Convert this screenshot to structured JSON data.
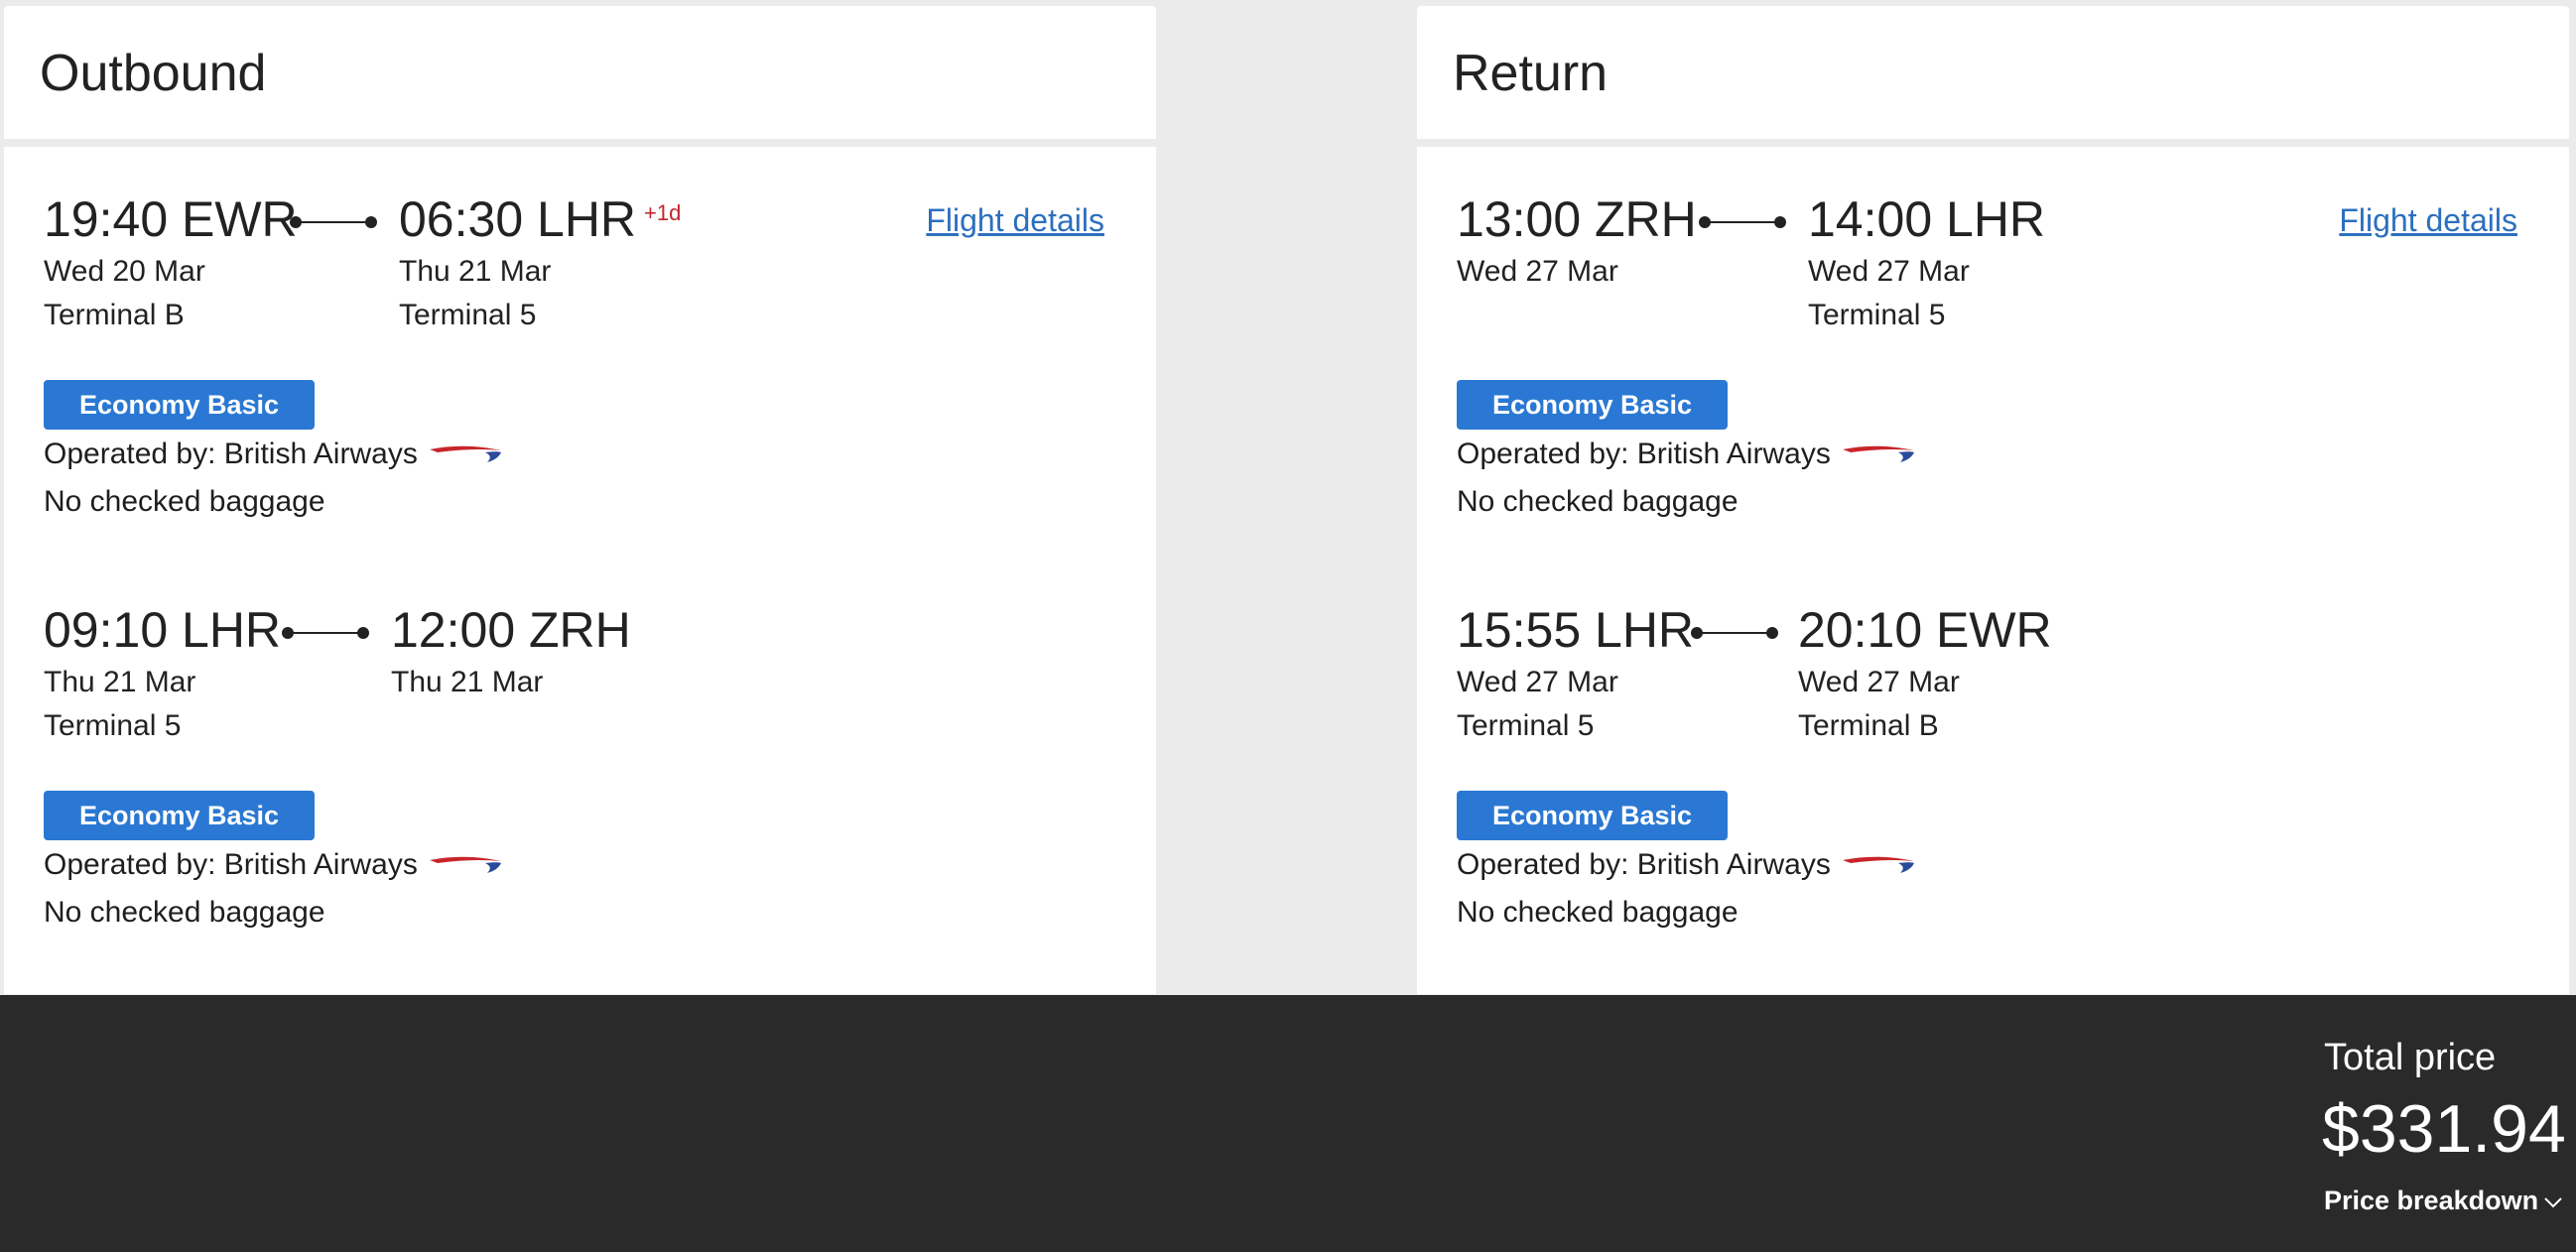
{
  "outbound": {
    "title": "Outbound",
    "details_link": "Flight details",
    "segments": [
      {
        "depart": {
          "time": "19:40 EWR",
          "date": "Wed 20 Mar",
          "terminal": "Terminal B"
        },
        "arrive": {
          "time": "06:30 LHR",
          "plus_day": "+1d",
          "date": "Thu 21 Mar",
          "terminal": "Terminal 5"
        },
        "cabin": "Economy Basic",
        "operated": "Operated by: British Airways",
        "baggage": "No checked baggage"
      },
      {
        "depart": {
          "time": "09:10 LHR",
          "date": "Thu 21 Mar",
          "terminal": "Terminal 5"
        },
        "arrive": {
          "time": "12:00 ZRH",
          "date": "Thu 21 Mar",
          "terminal": ""
        },
        "cabin": "Economy Basic",
        "operated": "Operated by: British Airways",
        "baggage": "No checked baggage"
      }
    ]
  },
  "return": {
    "title": "Return",
    "details_link": "Flight details",
    "segments": [
      {
        "depart": {
          "time": "13:00 ZRH",
          "date": "Wed 27 Mar",
          "terminal": ""
        },
        "arrive": {
          "time": "14:00 LHR",
          "date": "Wed 27 Mar",
          "terminal": "Terminal 5"
        },
        "cabin": "Economy Basic",
        "operated": "Operated by: British Airways",
        "baggage": "No checked baggage"
      },
      {
        "depart": {
          "time": "15:55 LHR",
          "date": "Wed 27 Mar",
          "terminal": "Terminal 5"
        },
        "arrive": {
          "time": "20:10 EWR",
          "date": "Wed 27 Mar",
          "terminal": "Terminal B"
        },
        "cabin": "Economy Basic",
        "operated": "Operated by: British Airways",
        "baggage": "No checked baggage"
      }
    ]
  },
  "footer": {
    "total_label": "Total price",
    "total_price": "$331.94",
    "breakdown_label": "Price breakdown"
  },
  "colors": {
    "cabin_badge": "#2a78d3",
    "link": "#2c6fbf",
    "plus_day": "#c0262d",
    "footer_bg": "#2a2a2a"
  },
  "icons": {
    "airline_logo": "british-airways-speedmarque-icon",
    "breakdown_toggle": "chevron-down-icon"
  }
}
